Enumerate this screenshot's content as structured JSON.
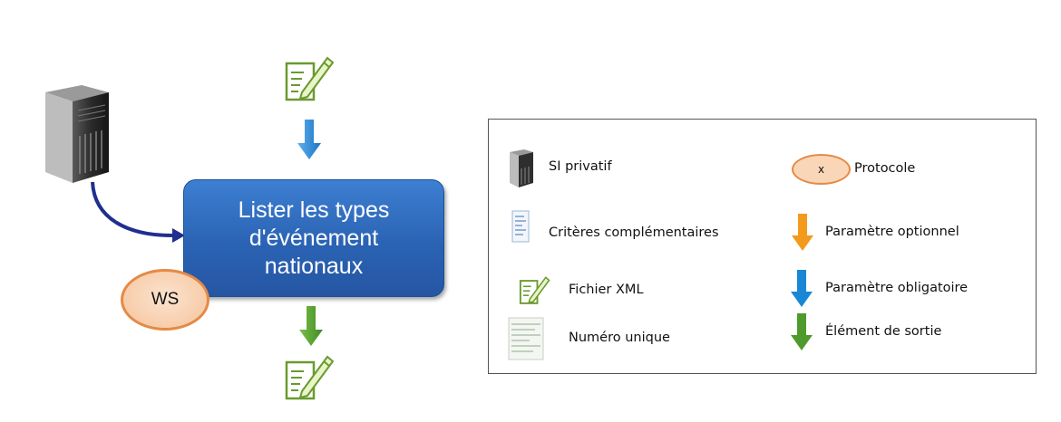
{
  "diagram": {
    "process": {
      "label": "Lister les types\nd'événement\nnationaux",
      "protocol": "WS"
    }
  },
  "legend": {
    "items": [
      {
        "icon": "server-icon",
        "label": "SI privatif"
      },
      {
        "icon": "protocol-ellipse",
        "symbol": "x",
        "label": "Protocole"
      },
      {
        "icon": "criteria-document-icon",
        "label": "Critères complémentaires"
      },
      {
        "icon": "orange-arrow-icon",
        "label": "Paramètre optionnel"
      },
      {
        "icon": "xml-file-icon",
        "label": "Fichier XML"
      },
      {
        "icon": "blue-arrow-icon",
        "label": "Paramètre obligatoire"
      },
      {
        "icon": "unique-number-icon",
        "label": "Numéro unique"
      },
      {
        "icon": "green-arrow-icon",
        "label": "Élément de sortie"
      }
    ]
  },
  "colors": {
    "process_fill": "#2b63b4",
    "protocol_fill": "#f7cdaa",
    "protocol_border": "#e58a45",
    "mandatory_arrow": "#1a86d6",
    "optional_arrow": "#f39a1c",
    "output_arrow": "#4f9a2c",
    "connector": "#1f2f8f"
  }
}
